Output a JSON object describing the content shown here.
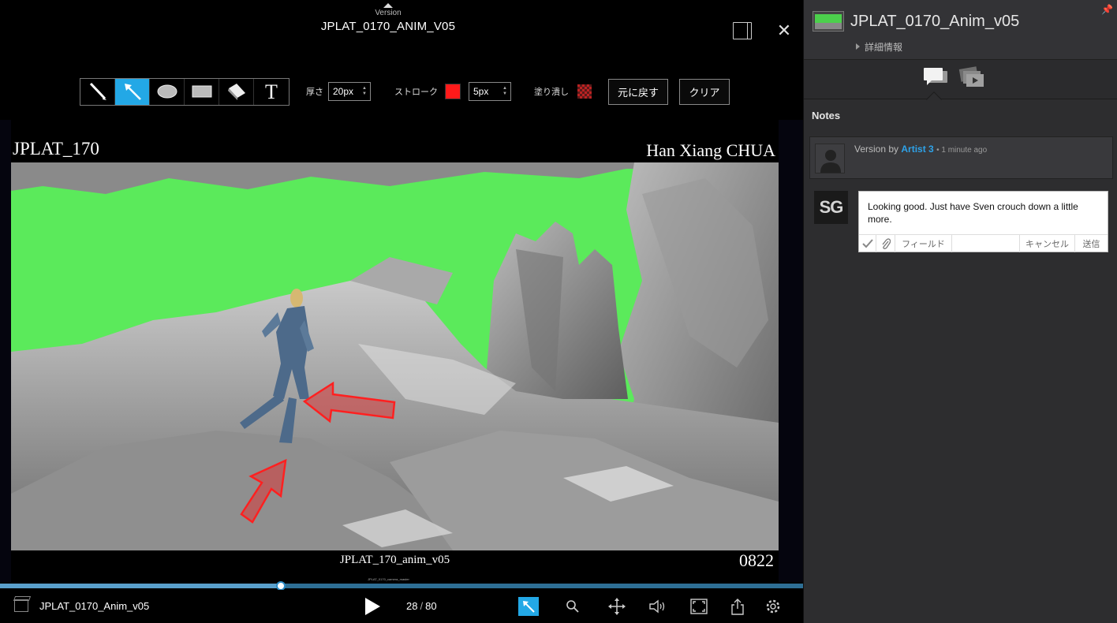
{
  "player": {
    "version_tab_label": "Version",
    "title": "JPLAT_0170_ANIM_V05",
    "toolbar": {
      "thickness_label": "厚さ",
      "thickness_value": "20px",
      "stroke_label": "ストローク",
      "stroke_color": "#ff1a1a",
      "stroke_value": "5px",
      "fill_label": "塗り潰し",
      "undo_label": "元に戻す",
      "clear_label": "クリア"
    },
    "frame": {
      "burnin_top_left": "JPLAT_170",
      "burnin_top_right": "Han Xiang CHUA",
      "burnin_bottom_center": "JPLAT_170_anim_v05",
      "burnin_bottom_right": "0822"
    },
    "timeline": {
      "label": "JPLAT_0170_camera_master",
      "progress": 0.35
    },
    "controls": {
      "version_name": "JPLAT_0170_Anim_v05",
      "current_frame": "28",
      "total_frames": "80"
    }
  },
  "panel": {
    "title": "JPLAT_0170_Anim_v05",
    "detail_link": "詳細情報",
    "notes_heading": "Notes",
    "note": {
      "prefix": "Version by",
      "author": "Artist 3",
      "time": "• 1 minute ago"
    },
    "reply": {
      "avatar_initials": "SG",
      "text": "Looking good. Just have Sven crouch down a little more.",
      "field_label": "フィールド",
      "cancel_label": "キャンセル",
      "send_label": "送信"
    }
  },
  "icons": {
    "accent": "#23a8e6"
  }
}
